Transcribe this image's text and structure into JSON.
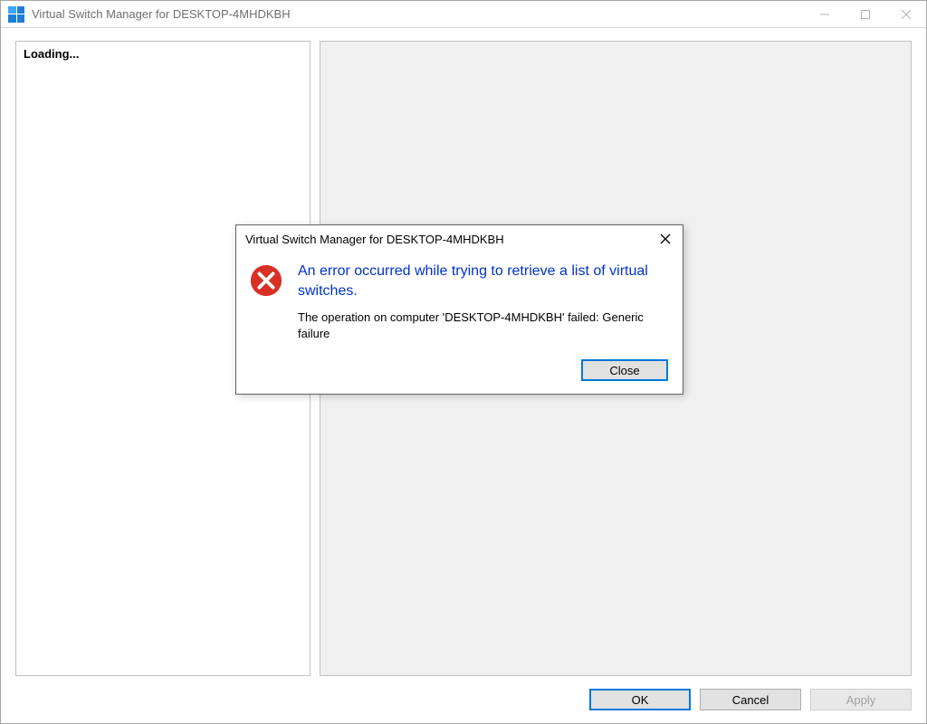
{
  "window": {
    "title": "Virtual Switch Manager for DESKTOP-4MHDKBH"
  },
  "sidebar": {
    "loading_text": "Loading..."
  },
  "buttons": {
    "ok": "OK",
    "cancel": "Cancel",
    "apply": "Apply"
  },
  "dialog": {
    "title": "Virtual Switch Manager for DESKTOP-4MHDKBH",
    "heading": "An error occurred while trying to retrieve a list of virtual switches.",
    "detail": "The operation on computer 'DESKTOP-4MHDKBH' failed: Generic failure",
    "close": "Close"
  }
}
